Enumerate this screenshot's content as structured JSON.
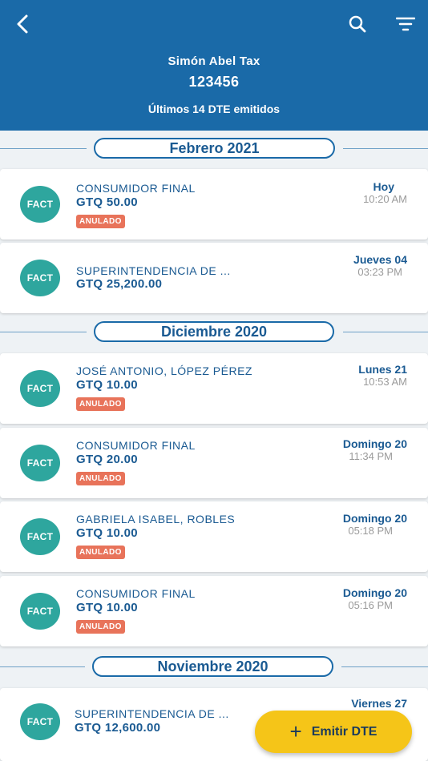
{
  "header": {
    "name": "Simón Abel Tax",
    "id": "123456",
    "subtitle": "Últimos 14 DTE emitidos",
    "back_icon": "chevron-left-icon",
    "search_icon": "search-icon",
    "filter_icon": "filter-icon"
  },
  "colors": {
    "header": "#1a6aa8",
    "avatar": "#2ea69e",
    "badge": "#e8735a",
    "fab": "#f5c518"
  },
  "months": [
    "Febrero 2021",
    "Diciembre 2020",
    "Noviembre 2020"
  ],
  "invoices": [
    {
      "type": "FACT",
      "name": "CONSUMIDOR FINAL",
      "amount": "GTQ 50.00",
      "status": "ANULADO",
      "day": "Hoy",
      "time": "10:20 AM"
    },
    {
      "type": "FACT",
      "name": "SUPERINTENDENCIA DE ...",
      "amount": "GTQ 25,200.00",
      "status": "",
      "day": "Jueves 04",
      "time": "03:23 PM"
    },
    {
      "type": "FACT",
      "name": "JOSÉ ANTONIO, LÓPEZ PÉREZ",
      "amount": "GTQ 10.00",
      "status": "ANULADO",
      "day": "Lunes 21",
      "time": "10:53 AM"
    },
    {
      "type": "FACT",
      "name": "CONSUMIDOR FINAL",
      "amount": "GTQ 20.00",
      "status": "ANULADO",
      "day": "Domingo 20",
      "time": "11:34 PM"
    },
    {
      "type": "FACT",
      "name": "GABRIELA ISABEL, ROBLES",
      "amount": "GTQ 10.00",
      "status": "ANULADO",
      "day": "Domingo 20",
      "time": "05:18 PM"
    },
    {
      "type": "FACT",
      "name": "CONSUMIDOR FINAL",
      "amount": "GTQ 10.00",
      "status": "ANULADO",
      "day": "Domingo 20",
      "time": "05:16 PM"
    },
    {
      "type": "FACT",
      "name": "SUPERINTENDENCIA DE ...",
      "amount": "GTQ 12,600.00",
      "status": "",
      "day": "Viernes 27",
      "time": ""
    }
  ],
  "fab": {
    "label": "Emitir DTE",
    "icon": "plus-icon"
  }
}
